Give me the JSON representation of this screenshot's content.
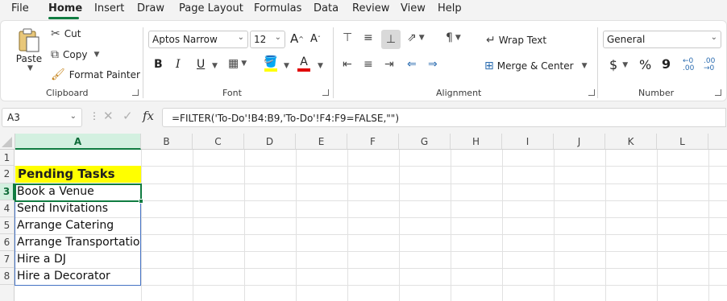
{
  "menu": {
    "tabs": [
      "File",
      "Home",
      "Insert",
      "Draw",
      "Page Layout",
      "Formulas",
      "Data",
      "Review",
      "View",
      "Help"
    ]
  },
  "ribbon": {
    "clipboard": {
      "label": "Clipboard",
      "paste": "Paste",
      "cut": "Cut",
      "copy": "Copy",
      "format_painter": "Format Painter"
    },
    "font": {
      "label": "Font",
      "name": "Aptos Narrow",
      "size": "12",
      "bold": "B",
      "italic": "I",
      "underline": "U",
      "grow": "A",
      "shrink": "A"
    },
    "alignment": {
      "label": "Alignment",
      "wrap_text": "Wrap Text",
      "merge_center": "Merge & Center"
    },
    "number": {
      "label": "Number",
      "format": "General",
      "currency": "$",
      "percent": "%",
      "comma": "9"
    }
  },
  "formula_bar": {
    "name_box": "A3",
    "fx": "fx",
    "formula": "=FILTER('To-Do'!B4:B9,'To-Do'!F4:F9=FALSE,\"\")"
  },
  "grid": {
    "columns": [
      "A",
      "B",
      "C",
      "D",
      "E",
      "F",
      "G",
      "H",
      "I",
      "J",
      "K",
      "L"
    ],
    "rows": [
      "1",
      "2",
      "3",
      "4",
      "5",
      "6",
      "7",
      "8"
    ],
    "header": "Pending Tasks",
    "tasks": [
      "Book a Venue",
      "Send Invitations",
      "Arrange Catering",
      "Arrange Transportation",
      "Hire a DJ",
      "Hire a Decorator"
    ]
  },
  "colors": {
    "accent": "#107c41",
    "highlight": "#ffff00",
    "spill_border": "#4472c4"
  }
}
